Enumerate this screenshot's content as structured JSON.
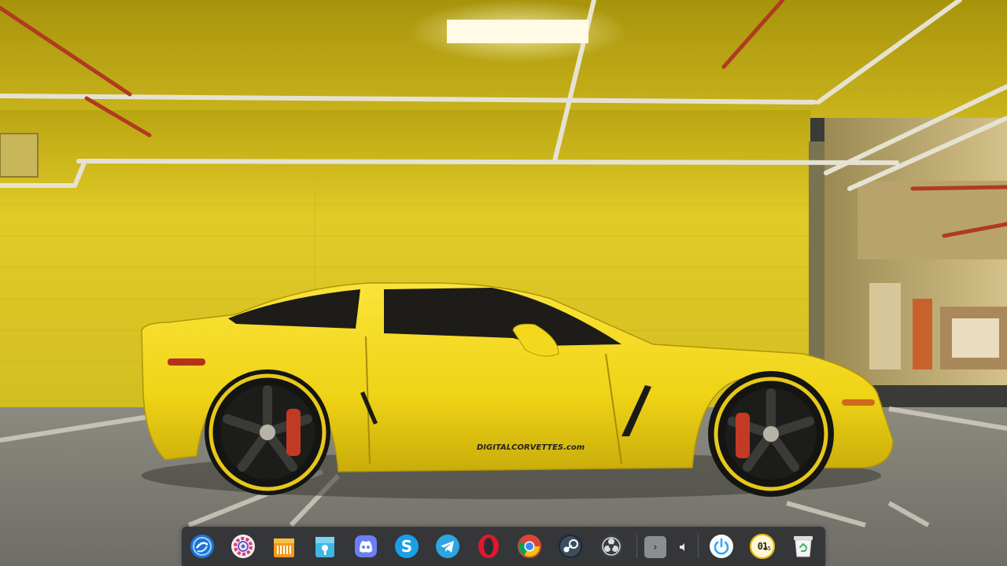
{
  "wallpaper": {
    "description_icon": "yellow-corvette-wallpaper",
    "car_decal_text": "DIGITALCORVETTES.com",
    "colors": {
      "wall": "#d8c31c",
      "floor": "#7e7d74",
      "car": "#f2d51a"
    }
  },
  "dock": {
    "apps": [
      {
        "name": "deepin-launcher",
        "icon": "deepin-logo-icon"
      },
      {
        "name": "control-center",
        "icon": "gear-icon"
      },
      {
        "name": "app-store",
        "icon": "store-bag-icon"
      },
      {
        "name": "file-manager",
        "icon": "folder-icon"
      },
      {
        "name": "discord",
        "icon": "discord-icon"
      },
      {
        "name": "skype",
        "icon": "skype-icon"
      },
      {
        "name": "telegram",
        "icon": "telegram-icon"
      },
      {
        "name": "opera",
        "icon": "opera-icon"
      },
      {
        "name": "chrome",
        "icon": "chrome-icon"
      },
      {
        "name": "steam",
        "icon": "steam-icon"
      },
      {
        "name": "obs",
        "icon": "obs-icon"
      }
    ],
    "tray": {
      "expand_label": "›",
      "volume_icon": "volume-icon"
    },
    "power_icon": "power-icon",
    "clock": {
      "hours": "01",
      "minutes": "35"
    },
    "trash_icon": "trash-icon",
    "accent": "#2ca7f8"
  }
}
